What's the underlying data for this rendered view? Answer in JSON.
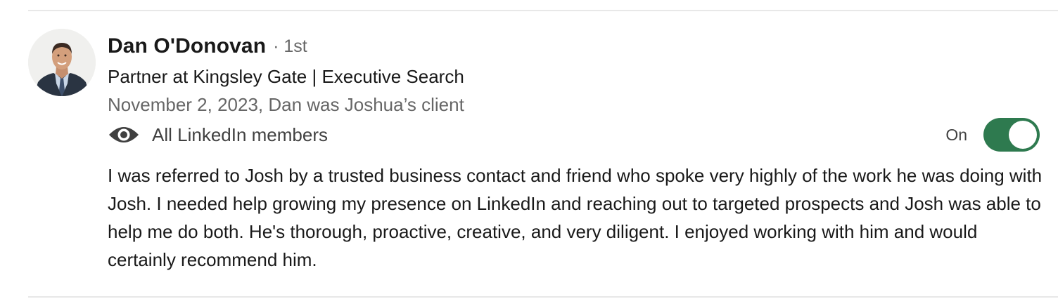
{
  "recommendation": {
    "name": "Dan O'Donovan",
    "degree": "· 1st",
    "headline": "Partner at Kingsley Gate | Executive Search",
    "meta": "November 2, 2023, Dan was Joshua’s client",
    "visibility": {
      "icon": "eye-icon",
      "label": "All LinkedIn members"
    },
    "toggle": {
      "state_label": "On",
      "on": true,
      "color": "#2e7a4f"
    },
    "text": "I was referred to Josh by a trusted business contact and friend who spoke very highly of the work he was doing with Josh. I needed help growing my presence on LinkedIn and reaching out to targeted prospects and Josh was able to help me do both. He's thorough, proactive, creative, and very diligent. I enjoyed working with him and would certainly recommend him."
  }
}
